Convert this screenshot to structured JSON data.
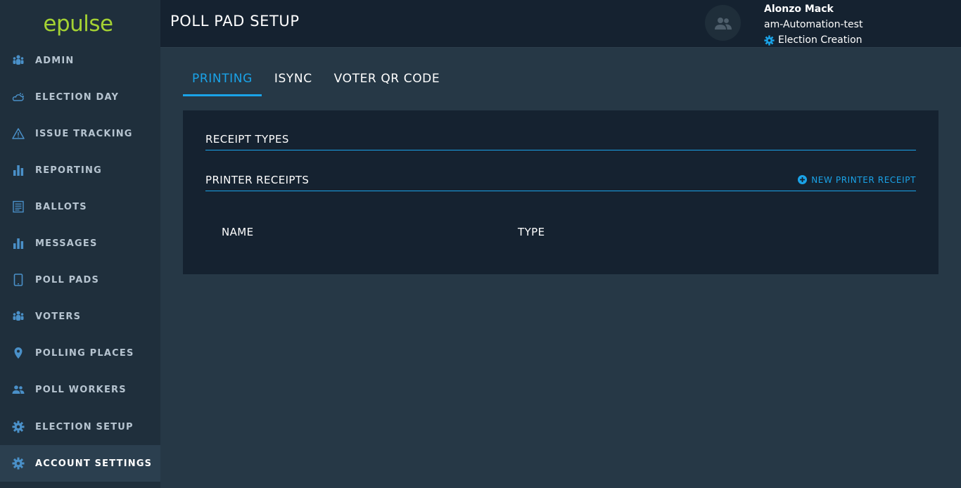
{
  "brand": {
    "logo_text": "epulse"
  },
  "header": {
    "title": "POLL PAD SETUP",
    "user": {
      "name": "Alonzo Mack",
      "org": "am-Automation-test",
      "role": "Election Creation"
    }
  },
  "sidebar": {
    "items": [
      {
        "label": "ADMIN",
        "icon": "users-icon"
      },
      {
        "label": "ELECTION DAY",
        "icon": "weather-icon"
      },
      {
        "label": "ISSUE TRACKING",
        "icon": "warning-icon"
      },
      {
        "label": "REPORTING",
        "icon": "bar-chart-icon"
      },
      {
        "label": "BALLOTS",
        "icon": "ballot-icon"
      },
      {
        "label": "MESSAGES",
        "icon": "bar-chart-icon"
      },
      {
        "label": "POLL PADS",
        "icon": "tablet-icon"
      },
      {
        "label": "VOTERS",
        "icon": "users-icon"
      },
      {
        "label": "POLLING PLACES",
        "icon": "map-pin-icon"
      },
      {
        "label": "POLL WORKERS",
        "icon": "people-icon"
      },
      {
        "label": "ELECTION SETUP",
        "icon": "gear-icon"
      },
      {
        "label": "ACCOUNT SETTINGS",
        "icon": "gear-icon",
        "active": true
      }
    ]
  },
  "tabs": [
    {
      "label": "PRINTING",
      "active": true
    },
    {
      "label": "ISYNC"
    },
    {
      "label": "VOTER QR CODE"
    }
  ],
  "panel": {
    "receipt_types_title": "RECEIPT TYPES",
    "printer_receipts_title": "PRINTER RECEIPTS",
    "new_receipt_label": "NEW PRINTER RECEIPT",
    "columns": [
      "NAME",
      "TYPE"
    ]
  },
  "colors": {
    "accent": "#1aa3e8",
    "brand": "#a4d233",
    "sidebar_bg": "#1f2f3c",
    "header_bg": "#152230",
    "content_bg": "#263846"
  }
}
